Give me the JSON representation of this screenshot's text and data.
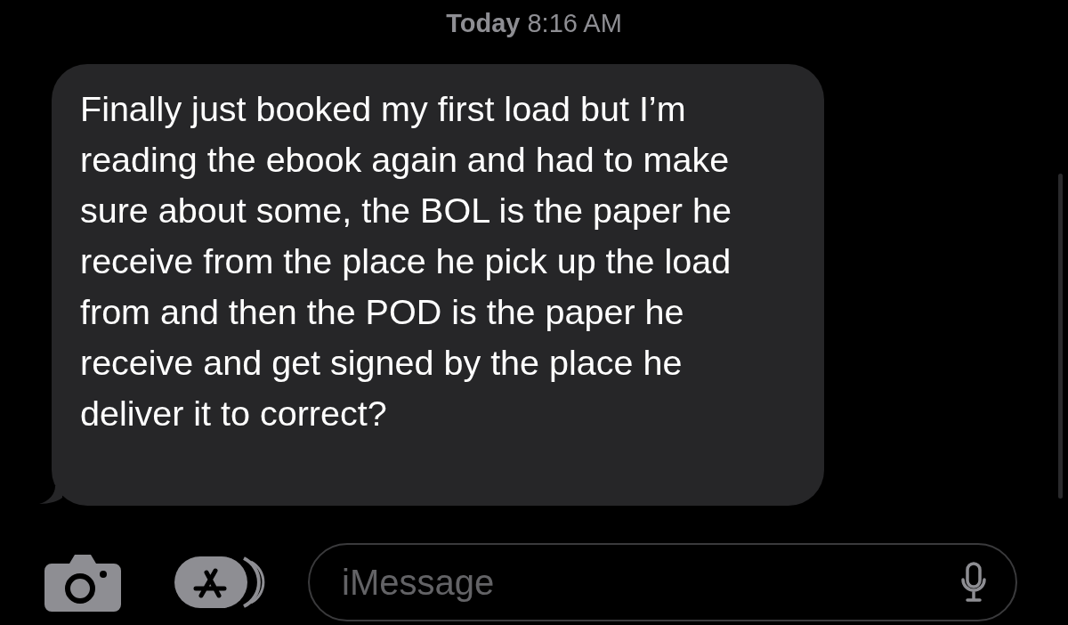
{
  "timestamp": "**Today** 8:16 AM",
  "messages": [
    {
      "kind": "received",
      "text": "Finally just booked my first load but I’m reading the ebook again and had to make sure about some, the BOL is the paper he receive from the place he pick up the load from and then the POD is the paper he receive and get signed by the place he deliver it to correct?"
    }
  ],
  "composer": {
    "placeholder": "iMessage"
  }
}
